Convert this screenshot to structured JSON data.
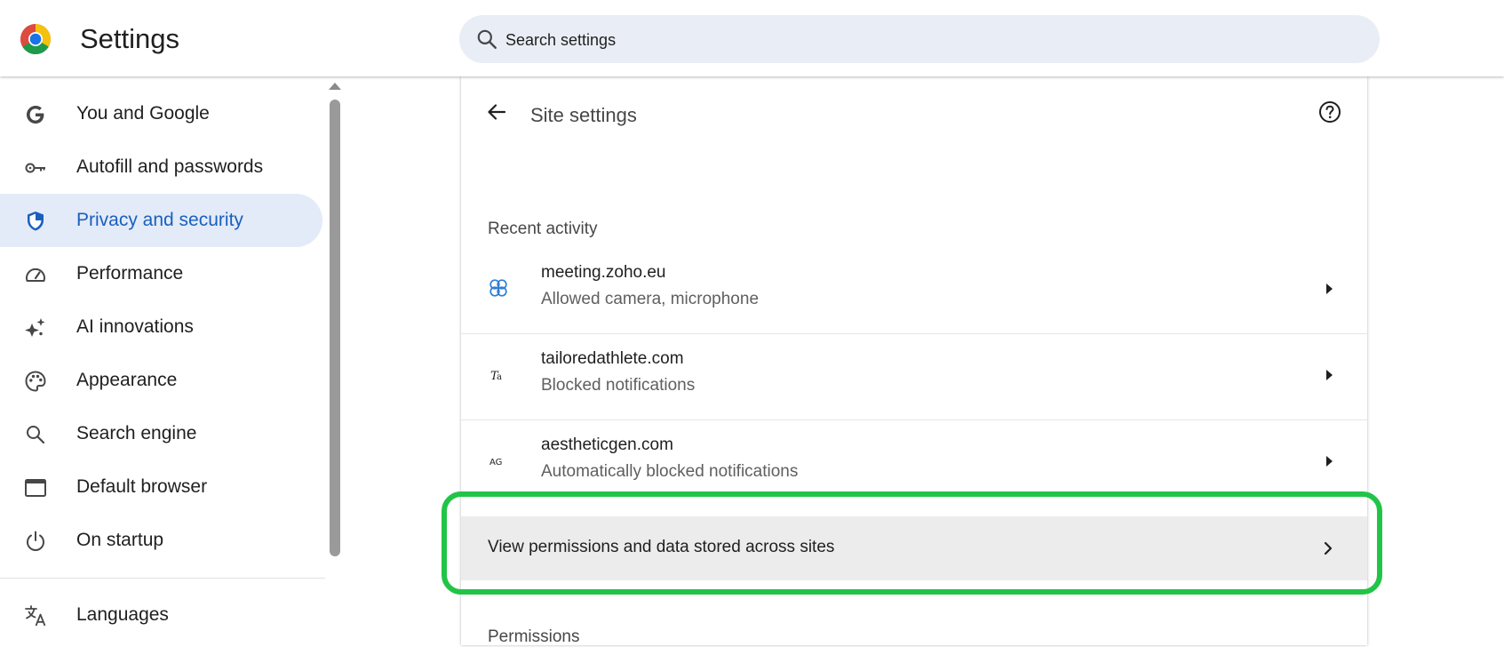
{
  "header": {
    "title": "Settings",
    "search": {
      "placeholder": "Search settings",
      "value": ""
    }
  },
  "sidebar": {
    "items": [
      {
        "label": "You and Google",
        "icon": "google-g-icon"
      },
      {
        "label": "Autofill and passwords",
        "icon": "key-icon"
      },
      {
        "label": "Privacy and security",
        "icon": "shield-icon",
        "active": true
      },
      {
        "label": "Performance",
        "icon": "speedometer-icon"
      },
      {
        "label": "AI innovations",
        "icon": "sparkle-icon"
      },
      {
        "label": "Appearance",
        "icon": "palette-icon"
      },
      {
        "label": "Search engine",
        "icon": "search-icon"
      },
      {
        "label": "Default browser",
        "icon": "browser-window-icon"
      },
      {
        "label": "On startup",
        "icon": "power-icon"
      },
      {
        "label": "Languages",
        "icon": "translate-icon"
      }
    ]
  },
  "main": {
    "title": "Site settings",
    "recent_activity": {
      "heading": "Recent activity",
      "items": [
        {
          "site": "meeting.zoho.eu",
          "detail": "Allowed camera, microphone",
          "icon": "zoho-icon"
        },
        {
          "site": "tailoredathlete.com",
          "detail": "Blocked notifications",
          "icon": "ta-icon"
        },
        {
          "site": "aestheticgen.com",
          "detail": "Automatically blocked notifications",
          "icon": "ag-icon"
        }
      ]
    },
    "view_all_label": "View permissions and data stored across sites",
    "permissions_heading": "Permissions"
  },
  "colors": {
    "accent": "#1a5fbf",
    "active_nav_bg": "#e3ebf8",
    "highlight_border": "#22c447",
    "search_bg": "#e9edf6"
  }
}
